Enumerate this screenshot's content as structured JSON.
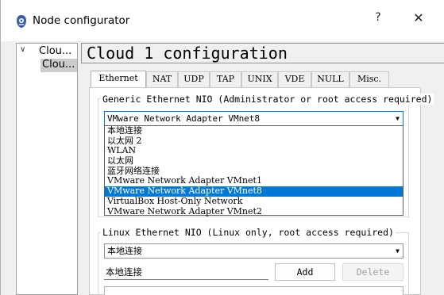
{
  "window": {
    "title": "Node configurator",
    "help_label": "?",
    "close_label": "✕"
  },
  "tree": {
    "toggle": "∨",
    "root_label": "Clou...",
    "child_label": "Clou..."
  },
  "page_title": "Cloud 1 configuration",
  "tabs": [
    "Ethernet",
    "NAT",
    "UDP",
    "TAP",
    "UNIX",
    "VDE",
    "NULL",
    "Misc."
  ],
  "active_tab": "Ethernet",
  "generic_ethernet": {
    "group_label": "Generic Ethernet NIO (Administrator or root access required)",
    "selected": "VMware Network Adapter VMnet8",
    "options": [
      "本地连接",
      "以太网 2",
      "WLAN",
      "以太网",
      "蓝牙网络连接",
      "VMware Network Adapter VMnet1",
      "VMware Network Adapter VMnet8",
      "VirtualBox Host-Only Network",
      "VMware Network Adapter VMnet2"
    ],
    "highlighted_index": 6
  },
  "linux_ethernet": {
    "group_label": "Linux Ethernet NIO (Linux only, root access required)",
    "selected": "本地连接",
    "text_value": "本地连接",
    "add_label": "Add",
    "delete_label": "Delete"
  }
}
